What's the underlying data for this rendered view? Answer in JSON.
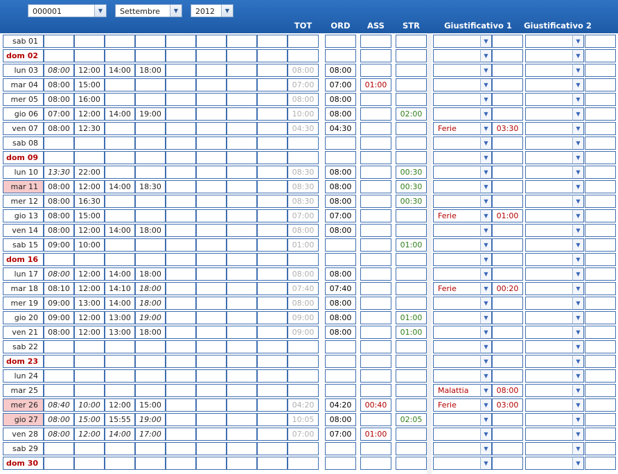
{
  "filters": {
    "employee": "000001",
    "month": "Settembre",
    "year": "2012"
  },
  "headers": {
    "tot": "TOT",
    "ord": "ORD",
    "ass": "ASS",
    "str": "STR",
    "giust1": "Giustificativo 1",
    "giust2": "Giustificativo 2"
  },
  "rows": [
    {
      "day": "sab 01",
      "sunday": false,
      "highlight": false,
      "times": [
        "",
        "",
        "",
        "",
        "",
        "",
        "",
        ""
      ],
      "tot": "",
      "ord": "",
      "ass": "",
      "str": "",
      "g1": "",
      "g1v": "",
      "g2": "",
      "g2v": ""
    },
    {
      "day": "dom 02",
      "sunday": true,
      "highlight": false,
      "times": [
        "",
        "",
        "",
        "",
        "",
        "",
        "",
        ""
      ],
      "tot": "",
      "ord": "",
      "ass": "",
      "str": "",
      "g1": "",
      "g1v": "",
      "g2": "",
      "g2v": ""
    },
    {
      "day": "lun 03",
      "sunday": false,
      "highlight": false,
      "times": [
        "08:00",
        "12:00",
        "14:00",
        "18:00",
        "",
        "",
        "",
        ""
      ],
      "italic": [
        true,
        false,
        false,
        false
      ],
      "tot": "08:00",
      "ord": "08:00",
      "ass": "",
      "str": "",
      "g1": "",
      "g1v": "",
      "g2": "",
      "g2v": ""
    },
    {
      "day": "mar 04",
      "sunday": false,
      "highlight": false,
      "times": [
        "08:00",
        "15:00",
        "",
        "",
        "",
        "",
        "",
        ""
      ],
      "italic": [
        false,
        false
      ],
      "tot": "07:00",
      "ord": "07:00",
      "ass": "01:00",
      "str": "",
      "g1": "",
      "g1v": "",
      "g2": "",
      "g2v": ""
    },
    {
      "day": "mer 05",
      "sunday": false,
      "highlight": false,
      "times": [
        "08:00",
        "16:00",
        "",
        "",
        "",
        "",
        "",
        ""
      ],
      "italic": [
        false,
        false
      ],
      "tot": "08:00",
      "ord": "08:00",
      "ass": "",
      "str": "",
      "g1": "",
      "g1v": "",
      "g2": "",
      "g2v": ""
    },
    {
      "day": "gio 06",
      "sunday": false,
      "highlight": false,
      "times": [
        "07:00",
        "12:00",
        "14:00",
        "19:00",
        "",
        "",
        "",
        ""
      ],
      "italic": [
        false,
        false,
        false,
        false
      ],
      "tot": "10:00",
      "ord": "08:00",
      "ass": "",
      "str": "02:00",
      "g1": "",
      "g1v": "",
      "g2": "",
      "g2v": ""
    },
    {
      "day": "ven 07",
      "sunday": false,
      "highlight": false,
      "times": [
        "08:00",
        "12:30",
        "",
        "",
        "",
        "",
        "",
        ""
      ],
      "italic": [
        false,
        false
      ],
      "tot": "04:30",
      "ord": "04:30",
      "ass": "",
      "str": "",
      "g1": "Ferie",
      "g1v": "03:30",
      "g2": "",
      "g2v": ""
    },
    {
      "day": "sab 08",
      "sunday": false,
      "highlight": false,
      "times": [
        "",
        "",
        "",
        "",
        "",
        "",
        "",
        ""
      ],
      "tot": "",
      "ord": "",
      "ass": "",
      "str": "",
      "g1": "",
      "g1v": "",
      "g2": "",
      "g2v": ""
    },
    {
      "day": "dom 09",
      "sunday": true,
      "highlight": false,
      "times": [
        "",
        "",
        "",
        "",
        "",
        "",
        "",
        ""
      ],
      "tot": "",
      "ord": "",
      "ass": "",
      "str": "",
      "g1": "",
      "g1v": "",
      "g2": "",
      "g2v": ""
    },
    {
      "day": "lun 10",
      "sunday": false,
      "highlight": false,
      "times": [
        "13:30",
        "22:00",
        "",
        "",
        "",
        "",
        "",
        ""
      ],
      "italic": [
        true,
        false
      ],
      "tot": "08:30",
      "ord": "08:00",
      "ass": "",
      "str": "00:30",
      "g1": "",
      "g1v": "",
      "g2": "",
      "g2v": ""
    },
    {
      "day": "mar 11",
      "sunday": false,
      "highlight": true,
      "times": [
        "08:00",
        "12:00",
        "14:00",
        "18:30",
        "",
        "",
        "",
        ""
      ],
      "italic": [
        false,
        false,
        false,
        false
      ],
      "tot": "08:30",
      "ord": "08:00",
      "ass": "",
      "str": "00:30",
      "g1": "",
      "g1v": "",
      "g2": "",
      "g2v": ""
    },
    {
      "day": "mer 12",
      "sunday": false,
      "highlight": false,
      "times": [
        "08:00",
        "16:30",
        "",
        "",
        "",
        "",
        "",
        ""
      ],
      "italic": [
        false,
        false
      ],
      "tot": "08:30",
      "ord": "08:00",
      "ass": "",
      "str": "00:30",
      "g1": "",
      "g1v": "",
      "g2": "",
      "g2v": ""
    },
    {
      "day": "gio 13",
      "sunday": false,
      "highlight": false,
      "times": [
        "08:00",
        "15:00",
        "",
        "",
        "",
        "",
        "",
        ""
      ],
      "italic": [
        false,
        false
      ],
      "tot": "07:00",
      "ord": "07:00",
      "ass": "",
      "str": "",
      "g1": "Ferie",
      "g1v": "01:00",
      "g2": "",
      "g2v": ""
    },
    {
      "day": "ven 14",
      "sunday": false,
      "highlight": false,
      "times": [
        "08:00",
        "12:00",
        "14:00",
        "18:00",
        "",
        "",
        "",
        ""
      ],
      "italic": [
        false,
        false,
        false,
        false
      ],
      "tot": "08:00",
      "ord": "08:00",
      "ass": "",
      "str": "",
      "g1": "",
      "g1v": "",
      "g2": "",
      "g2v": ""
    },
    {
      "day": "sab 15",
      "sunday": false,
      "highlight": false,
      "times": [
        "09:00",
        "10:00",
        "",
        "",
        "",
        "",
        "",
        ""
      ],
      "italic": [
        false,
        false
      ],
      "tot": "01:00",
      "ord": "",
      "ass": "",
      "str": "01:00",
      "g1": "",
      "g1v": "",
      "g2": "",
      "g2v": ""
    },
    {
      "day": "dom 16",
      "sunday": true,
      "highlight": false,
      "times": [
        "",
        "",
        "",
        "",
        "",
        "",
        "",
        ""
      ],
      "tot": "",
      "ord": "",
      "ass": "",
      "str": "",
      "g1": "",
      "g1v": "",
      "g2": "",
      "g2v": ""
    },
    {
      "day": "lun 17",
      "sunday": false,
      "highlight": false,
      "times": [
        "08:00",
        "12:00",
        "14:00",
        "18:00",
        "",
        "",
        "",
        ""
      ],
      "italic": [
        true,
        false,
        false,
        false
      ],
      "tot": "08:00",
      "ord": "08:00",
      "ass": "",
      "str": "",
      "g1": "",
      "g1v": "",
      "g2": "",
      "g2v": ""
    },
    {
      "day": "mar 18",
      "sunday": false,
      "highlight": false,
      "times": [
        "08:10",
        "12:00",
        "14:10",
        "18:00",
        "",
        "",
        "",
        ""
      ],
      "italic": [
        false,
        false,
        false,
        true
      ],
      "tot": "07:40",
      "ord": "07:40",
      "ass": "",
      "str": "",
      "g1": "Ferie",
      "g1v": "00:20",
      "g2": "",
      "g2v": ""
    },
    {
      "day": "mer 19",
      "sunday": false,
      "highlight": false,
      "times": [
        "09:00",
        "13:00",
        "14:00",
        "18:00",
        "",
        "",
        "",
        ""
      ],
      "italic": [
        false,
        false,
        false,
        true
      ],
      "tot": "08:00",
      "ord": "08:00",
      "ass": "",
      "str": "",
      "g1": "",
      "g1v": "",
      "g2": "",
      "g2v": ""
    },
    {
      "day": "gio 20",
      "sunday": false,
      "highlight": false,
      "times": [
        "09:00",
        "12:00",
        "13:00",
        "19:00",
        "",
        "",
        "",
        ""
      ],
      "italic": [
        false,
        false,
        false,
        true
      ],
      "tot": "09:00",
      "ord": "08:00",
      "ass": "",
      "str": "01:00",
      "g1": "",
      "g1v": "",
      "g2": "",
      "g2v": ""
    },
    {
      "day": "ven 21",
      "sunday": false,
      "highlight": false,
      "times": [
        "08:00",
        "12:00",
        "13:00",
        "18:00",
        "",
        "",
        "",
        ""
      ],
      "italic": [
        false,
        false,
        false,
        false
      ],
      "tot": "09:00",
      "ord": "08:00",
      "ass": "",
      "str": "01:00",
      "g1": "",
      "g1v": "",
      "g2": "",
      "g2v": ""
    },
    {
      "day": "sab 22",
      "sunday": false,
      "highlight": false,
      "times": [
        "",
        "",
        "",
        "",
        "",
        "",
        "",
        ""
      ],
      "tot": "",
      "ord": "",
      "ass": "",
      "str": "",
      "g1": "",
      "g1v": "",
      "g2": "",
      "g2v": ""
    },
    {
      "day": "dom 23",
      "sunday": true,
      "highlight": false,
      "times": [
        "",
        "",
        "",
        "",
        "",
        "",
        "",
        ""
      ],
      "tot": "",
      "ord": "",
      "ass": "",
      "str": "",
      "g1": "",
      "g1v": "",
      "g2": "",
      "g2v": ""
    },
    {
      "day": "lun 24",
      "sunday": false,
      "highlight": false,
      "times": [
        "",
        "",
        "",
        "",
        "",
        "",
        "",
        ""
      ],
      "tot": "",
      "ord": "",
      "ass": "",
      "str": "",
      "g1": "",
      "g1v": "",
      "g2": "",
      "g2v": ""
    },
    {
      "day": "mar 25",
      "sunday": false,
      "highlight": false,
      "times": [
        "",
        "",
        "",
        "",
        "",
        "",
        "",
        ""
      ],
      "tot": "",
      "ord": "",
      "ass": "",
      "str": "",
      "g1": "Malattia",
      "g1v": "08:00",
      "g2": "",
      "g2v": ""
    },
    {
      "day": "mer 26",
      "sunday": false,
      "highlight": true,
      "times": [
        "08:40",
        "10:00",
        "12:00",
        "15:00",
        "",
        "",
        "",
        ""
      ],
      "italic": [
        true,
        true,
        false,
        false
      ],
      "tot": "04:20",
      "ord": "04:20",
      "ass": "00:40",
      "str": "",
      "g1": "Ferie",
      "g1v": "03:00",
      "g2": "",
      "g2v": ""
    },
    {
      "day": "gio 27",
      "sunday": false,
      "highlight": true,
      "times": [
        "08:00",
        "15:00",
        "15:55",
        "19:00",
        "",
        "",
        "",
        ""
      ],
      "italic": [
        true,
        true,
        false,
        true
      ],
      "tot": "10:05",
      "ord": "08:00",
      "ass": "",
      "str": "02:05",
      "g1": "",
      "g1v": "",
      "g2": "",
      "g2v": ""
    },
    {
      "day": "ven 28",
      "sunday": false,
      "highlight": false,
      "times": [
        "08:00",
        "12:00",
        "14:00",
        "17:00",
        "",
        "",
        "",
        ""
      ],
      "italic": [
        true,
        true,
        true,
        true
      ],
      "tot": "07:00",
      "ord": "07:00",
      "ass": "01:00",
      "str": "",
      "g1": "",
      "g1v": "",
      "g2": "",
      "g2v": ""
    },
    {
      "day": "sab 29",
      "sunday": false,
      "highlight": false,
      "times": [
        "",
        "",
        "",
        "",
        "",
        "",
        "",
        ""
      ],
      "tot": "",
      "ord": "",
      "ass": "",
      "str": "",
      "g1": "",
      "g1v": "",
      "g2": "",
      "g2v": ""
    },
    {
      "day": "dom 30",
      "sunday": true,
      "highlight": false,
      "times": [
        "",
        "",
        "",
        "",
        "",
        "",
        "",
        ""
      ],
      "tot": "",
      "ord": "",
      "ass": "",
      "str": "",
      "g1": "",
      "g1v": "",
      "g2": "",
      "g2v": ""
    }
  ],
  "icons": {
    "dropdown": "▼"
  },
  "colors": {
    "header_bg": "#1d5aa6",
    "sunday": "#b30000",
    "highlight": "#f7c9c9",
    "absence": "#b30000",
    "overtime": "#2f7d1a",
    "total": "#b0b0b0"
  }
}
